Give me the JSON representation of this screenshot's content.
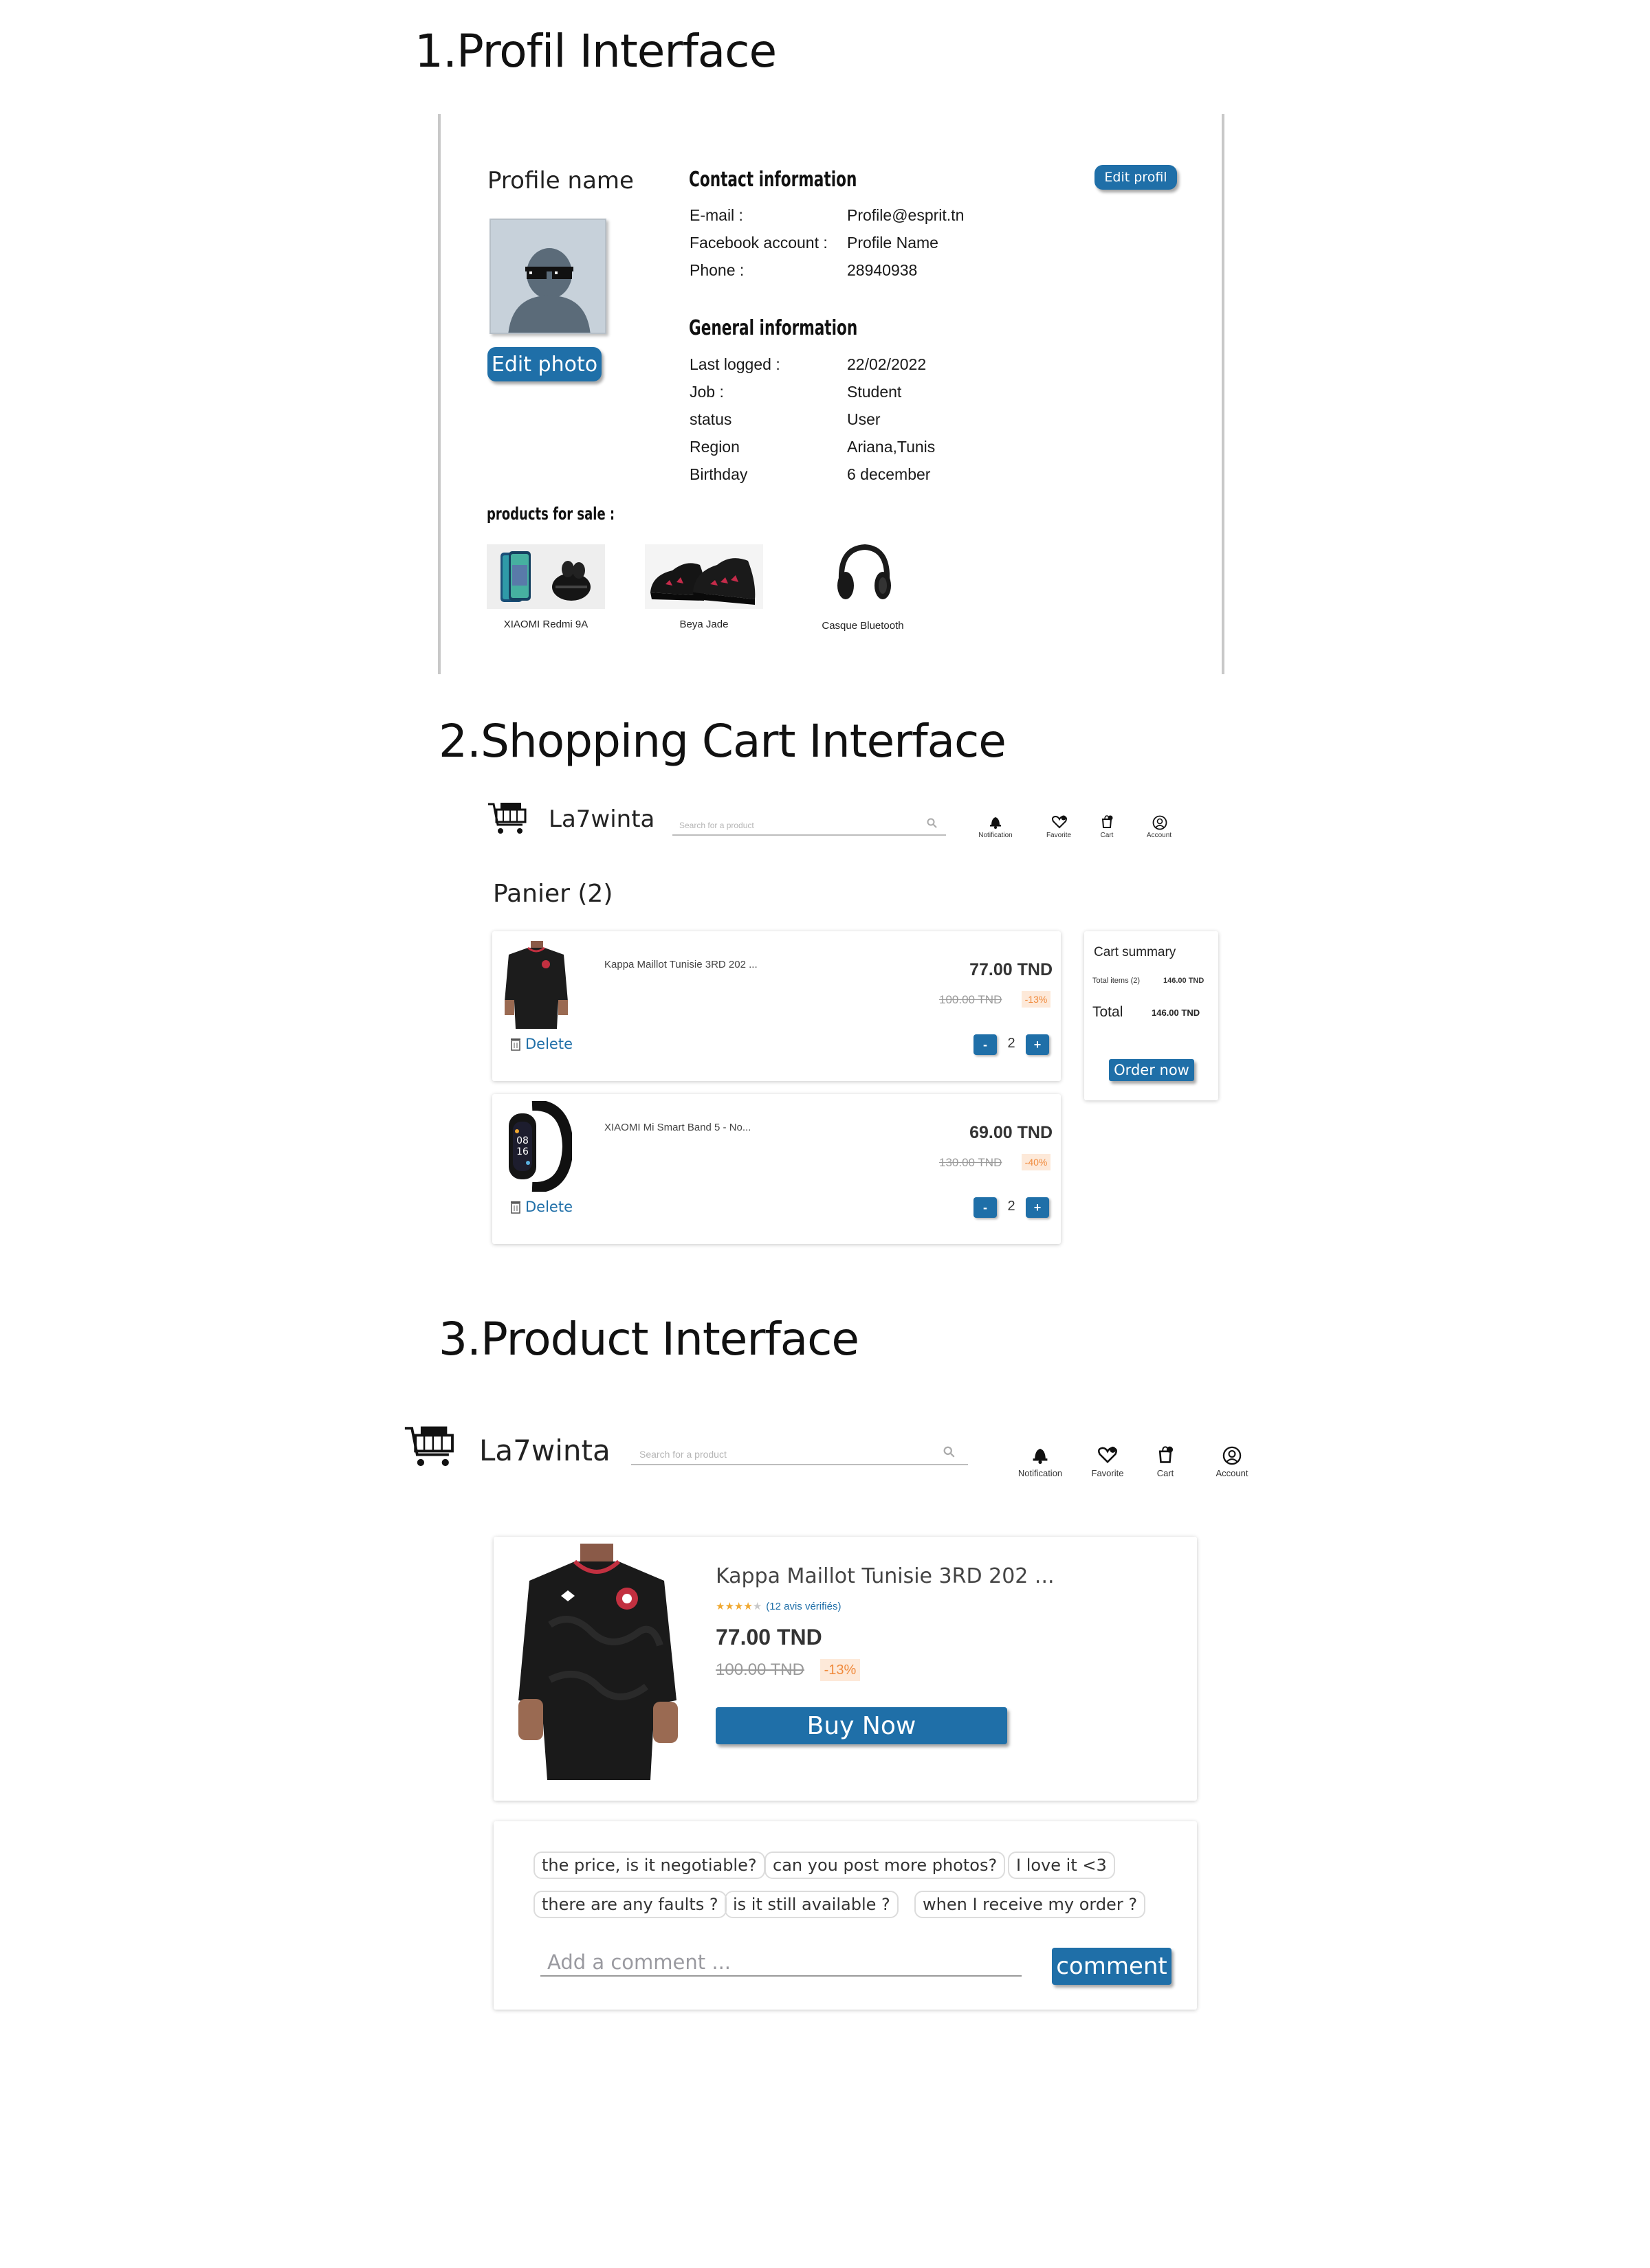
{
  "sections": {
    "profile_title": "1.Profil Interface",
    "cart_title": "2.Shopping Cart Interface",
    "product_title": "3.Product Interface"
  },
  "profile": {
    "name": "Profile name",
    "edit_photo": "Edit photo",
    "edit_profile": "Edit profil",
    "contact_heading": "Contact information",
    "contact": [
      {
        "label": "E-mail :",
        "value": "Profile@esprit.tn"
      },
      {
        "label": "Facebook account :",
        "value": "Profile Name"
      },
      {
        "label": "Phone :",
        "value": "28940938"
      }
    ],
    "general_heading": "General information",
    "general": [
      {
        "label": "Last logged :",
        "value": "22/02/2022"
      },
      {
        "label": "Job :",
        "value": "Student"
      },
      {
        "label": "status",
        "value": "User"
      },
      {
        "label": "Region",
        "value": "Ariana,Tunis"
      },
      {
        "label": "Birthday",
        "value": "6 december"
      }
    ],
    "products_heading": "products for sale :",
    "products": [
      {
        "name": "XIAOMI Redmi 9A"
      },
      {
        "name": "Beya Jade"
      },
      {
        "name": "Casque Bluetooth"
      }
    ]
  },
  "header": {
    "brand": "La7winta",
    "search_placeholder": "Search for a product",
    "nav": [
      {
        "label": "Notification",
        "icon": "bell-icon"
      },
      {
        "label": "Favorite",
        "icon": "heart-icon"
      },
      {
        "label": "Cart",
        "icon": "cart-icon"
      },
      {
        "label": "Account",
        "icon": "account-icon"
      }
    ]
  },
  "cart": {
    "title": "Panier (2)",
    "items": [
      {
        "name": "Kappa Maillot Tunisie 3RD 202 ...",
        "price": "77.00 TND",
        "old_price": "100.00 TND",
        "discount": "-13%",
        "qty": "2",
        "delete": "Delete"
      },
      {
        "name": "XIAOMI Mi Smart Band 5 - No...",
        "price": "69.00 TND",
        "old_price": "130.00 TND",
        "discount": "-40%",
        "qty": "2",
        "delete": "Delete"
      }
    ],
    "summary": {
      "title": "Cart summary",
      "items_label": "Total items (2)",
      "items_value": "146.00 TND",
      "total_label": "Total",
      "total_value": "146.00 TND",
      "order_button": "Order now"
    },
    "minus": "-",
    "plus": "+",
    "band_time_1": "08",
    "band_time_2": "16"
  },
  "product": {
    "title": "Kappa Maillot Tunisie 3RD 202 ...",
    "rating": 4,
    "rating_max": 5,
    "reviews": "(12 avis vérifiés)",
    "price": "77.00 TND",
    "old_price": "100.00 TND",
    "discount": "-13%",
    "buy_button": "Buy Now",
    "chips": [
      "the price, is it negotiable?",
      "can you post more photos?",
      "I love it <3",
      "there are any faults ?",
      "is it still available ?",
      "when I receive my order ?"
    ],
    "comment_placeholder": "Add a comment ...",
    "comment_button": "comment"
  },
  "colors": {
    "accent": "#1f6fa8",
    "discount_bg": "#fde9d9",
    "discount_text": "#f08a3c",
    "star": "#f0a830"
  }
}
